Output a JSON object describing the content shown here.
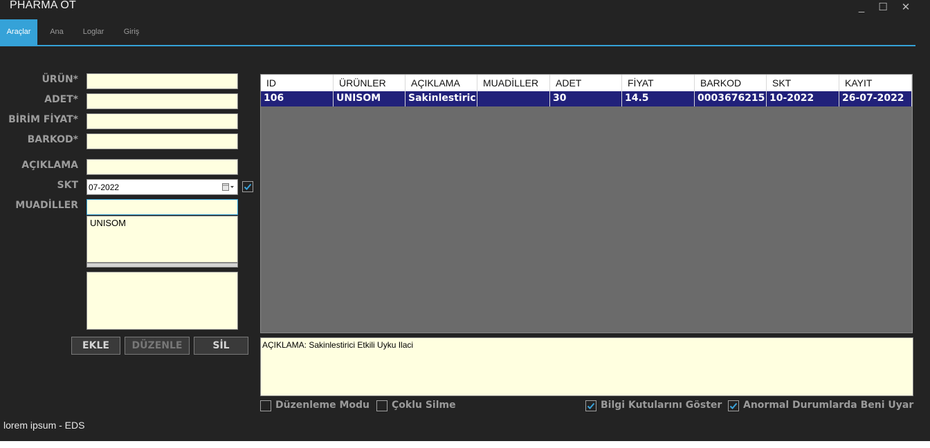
{
  "window": {
    "title": "PHARMA OT",
    "minimize": "_",
    "maximize": "☐",
    "close": "✕"
  },
  "tabs": [
    {
      "label": "Araçlar",
      "active": true
    },
    {
      "label": "Ana",
      "active": false
    },
    {
      "label": "Loglar",
      "active": false
    },
    {
      "label": "Giriş",
      "active": false
    }
  ],
  "form": {
    "urun_label": "ÜRÜN*",
    "adet_label": "ADET*",
    "birim_fiyat_label": "BİRİM FİYAT*",
    "barkod_label": "BARKOD*",
    "aciklama_label": "AÇIKLAMA",
    "skt_label": "SKT",
    "muadiller_label": "MUADİLLER",
    "urun_value": "",
    "adet_value": "",
    "birim_fiyat_value": "",
    "barkod_value": "",
    "aciklama_value": "",
    "skt_value": "07-2022",
    "skt_checked": true,
    "muadiller_search_value": "",
    "muadiller_list": [
      "UNISOM"
    ],
    "notes_value": ""
  },
  "buttons": {
    "ekle": "EKLE",
    "duzenle": "DÜZENLE",
    "sil": "SİL"
  },
  "table": {
    "columns": [
      "ID",
      "ÜRÜNLER",
      "AÇIKLAMA",
      "MUADİLLER",
      "ADET",
      "FİYAT",
      "BARKOD",
      "SKT",
      "KAYIT"
    ],
    "rows": [
      [
        "106",
        "UNISOM",
        "Sakinlestiric",
        "",
        "30",
        "14.5",
        "0003676215",
        "10-2022",
        "26-07-2022"
      ]
    ]
  },
  "info_text": "AÇIKLAMA: Sakinlestirici Etkili Uyku Ilaci",
  "options": {
    "duzenleme_modu": {
      "label": "Düzenleme Modu",
      "checked": false
    },
    "coklu_silme": {
      "label": "Çoklu Silme",
      "checked": false
    },
    "bilgi_kutulari": {
      "label": "Bilgi Kutularını Göster",
      "checked": true
    },
    "anormal_durum": {
      "label": "Anormal Durumlarda Beni Uyar",
      "checked": true
    }
  },
  "footer": "lorem ipsum - EDS",
  "colors": {
    "accent": "#35a2d8",
    "background": "#232323",
    "selected_row": "#21217a",
    "input_bg": "#ffffe0"
  }
}
